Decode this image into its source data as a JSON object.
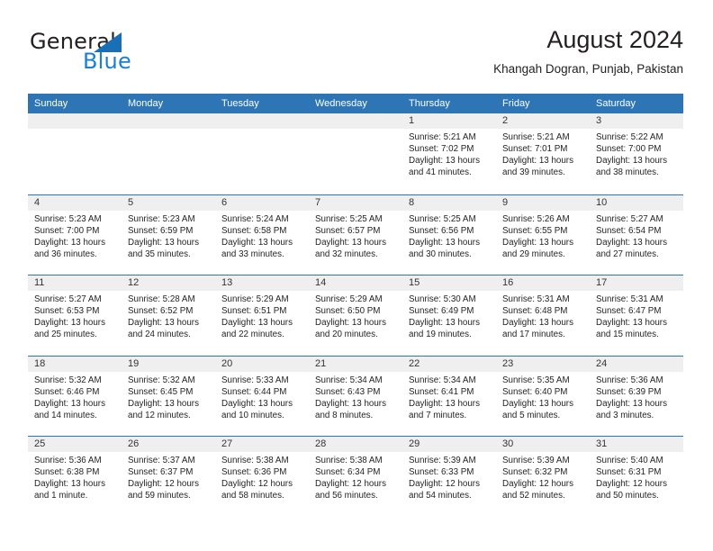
{
  "brand": {
    "name_part1": "General",
    "name_part2": "Blue"
  },
  "header": {
    "title": "August 2024",
    "location": "Khangah Dogran, Punjab, Pakistan"
  },
  "colors": {
    "header_blue": "#2e75b6",
    "logo_blue": "#1b7fd4",
    "day_band_gray": "#efefef",
    "text": "#231f20"
  },
  "weekdays": [
    "Sunday",
    "Monday",
    "Tuesday",
    "Wednesday",
    "Thursday",
    "Friday",
    "Saturday"
  ],
  "weeks": [
    [
      {
        "empty": true
      },
      {
        "empty": true
      },
      {
        "empty": true
      },
      {
        "empty": true
      },
      {
        "day": "1",
        "sunrise": "Sunrise: 5:21 AM",
        "sunset": "Sunset: 7:02 PM",
        "daylight": "Daylight: 13 hours and 41 minutes."
      },
      {
        "day": "2",
        "sunrise": "Sunrise: 5:21 AM",
        "sunset": "Sunset: 7:01 PM",
        "daylight": "Daylight: 13 hours and 39 minutes."
      },
      {
        "day": "3",
        "sunrise": "Sunrise: 5:22 AM",
        "sunset": "Sunset: 7:00 PM",
        "daylight": "Daylight: 13 hours and 38 minutes."
      }
    ],
    [
      {
        "day": "4",
        "sunrise": "Sunrise: 5:23 AM",
        "sunset": "Sunset: 7:00 PM",
        "daylight": "Daylight: 13 hours and 36 minutes."
      },
      {
        "day": "5",
        "sunrise": "Sunrise: 5:23 AM",
        "sunset": "Sunset: 6:59 PM",
        "daylight": "Daylight: 13 hours and 35 minutes."
      },
      {
        "day": "6",
        "sunrise": "Sunrise: 5:24 AM",
        "sunset": "Sunset: 6:58 PM",
        "daylight": "Daylight: 13 hours and 33 minutes."
      },
      {
        "day": "7",
        "sunrise": "Sunrise: 5:25 AM",
        "sunset": "Sunset: 6:57 PM",
        "daylight": "Daylight: 13 hours and 32 minutes."
      },
      {
        "day": "8",
        "sunrise": "Sunrise: 5:25 AM",
        "sunset": "Sunset: 6:56 PM",
        "daylight": "Daylight: 13 hours and 30 minutes."
      },
      {
        "day": "9",
        "sunrise": "Sunrise: 5:26 AM",
        "sunset": "Sunset: 6:55 PM",
        "daylight": "Daylight: 13 hours and 29 minutes."
      },
      {
        "day": "10",
        "sunrise": "Sunrise: 5:27 AM",
        "sunset": "Sunset: 6:54 PM",
        "daylight": "Daylight: 13 hours and 27 minutes."
      }
    ],
    [
      {
        "day": "11",
        "sunrise": "Sunrise: 5:27 AM",
        "sunset": "Sunset: 6:53 PM",
        "daylight": "Daylight: 13 hours and 25 minutes."
      },
      {
        "day": "12",
        "sunrise": "Sunrise: 5:28 AM",
        "sunset": "Sunset: 6:52 PM",
        "daylight": "Daylight: 13 hours and 24 minutes."
      },
      {
        "day": "13",
        "sunrise": "Sunrise: 5:29 AM",
        "sunset": "Sunset: 6:51 PM",
        "daylight": "Daylight: 13 hours and 22 minutes."
      },
      {
        "day": "14",
        "sunrise": "Sunrise: 5:29 AM",
        "sunset": "Sunset: 6:50 PM",
        "daylight": "Daylight: 13 hours and 20 minutes."
      },
      {
        "day": "15",
        "sunrise": "Sunrise: 5:30 AM",
        "sunset": "Sunset: 6:49 PM",
        "daylight": "Daylight: 13 hours and 19 minutes."
      },
      {
        "day": "16",
        "sunrise": "Sunrise: 5:31 AM",
        "sunset": "Sunset: 6:48 PM",
        "daylight": "Daylight: 13 hours and 17 minutes."
      },
      {
        "day": "17",
        "sunrise": "Sunrise: 5:31 AM",
        "sunset": "Sunset: 6:47 PM",
        "daylight": "Daylight: 13 hours and 15 minutes."
      }
    ],
    [
      {
        "day": "18",
        "sunrise": "Sunrise: 5:32 AM",
        "sunset": "Sunset: 6:46 PM",
        "daylight": "Daylight: 13 hours and 14 minutes."
      },
      {
        "day": "19",
        "sunrise": "Sunrise: 5:32 AM",
        "sunset": "Sunset: 6:45 PM",
        "daylight": "Daylight: 13 hours and 12 minutes."
      },
      {
        "day": "20",
        "sunrise": "Sunrise: 5:33 AM",
        "sunset": "Sunset: 6:44 PM",
        "daylight": "Daylight: 13 hours and 10 minutes."
      },
      {
        "day": "21",
        "sunrise": "Sunrise: 5:34 AM",
        "sunset": "Sunset: 6:43 PM",
        "daylight": "Daylight: 13 hours and 8 minutes."
      },
      {
        "day": "22",
        "sunrise": "Sunrise: 5:34 AM",
        "sunset": "Sunset: 6:41 PM",
        "daylight": "Daylight: 13 hours and 7 minutes."
      },
      {
        "day": "23",
        "sunrise": "Sunrise: 5:35 AM",
        "sunset": "Sunset: 6:40 PM",
        "daylight": "Daylight: 13 hours and 5 minutes."
      },
      {
        "day": "24",
        "sunrise": "Sunrise: 5:36 AM",
        "sunset": "Sunset: 6:39 PM",
        "daylight": "Daylight: 13 hours and 3 minutes."
      }
    ],
    [
      {
        "day": "25",
        "sunrise": "Sunrise: 5:36 AM",
        "sunset": "Sunset: 6:38 PM",
        "daylight": "Daylight: 13 hours and 1 minute."
      },
      {
        "day": "26",
        "sunrise": "Sunrise: 5:37 AM",
        "sunset": "Sunset: 6:37 PM",
        "daylight": "Daylight: 12 hours and 59 minutes."
      },
      {
        "day": "27",
        "sunrise": "Sunrise: 5:38 AM",
        "sunset": "Sunset: 6:36 PM",
        "daylight": "Daylight: 12 hours and 58 minutes."
      },
      {
        "day": "28",
        "sunrise": "Sunrise: 5:38 AM",
        "sunset": "Sunset: 6:34 PM",
        "daylight": "Daylight: 12 hours and 56 minutes."
      },
      {
        "day": "29",
        "sunrise": "Sunrise: 5:39 AM",
        "sunset": "Sunset: 6:33 PM",
        "daylight": "Daylight: 12 hours and 54 minutes."
      },
      {
        "day": "30",
        "sunrise": "Sunrise: 5:39 AM",
        "sunset": "Sunset: 6:32 PM",
        "daylight": "Daylight: 12 hours and 52 minutes."
      },
      {
        "day": "31",
        "sunrise": "Sunrise: 5:40 AM",
        "sunset": "Sunset: 6:31 PM",
        "daylight": "Daylight: 12 hours and 50 minutes."
      }
    ]
  ]
}
